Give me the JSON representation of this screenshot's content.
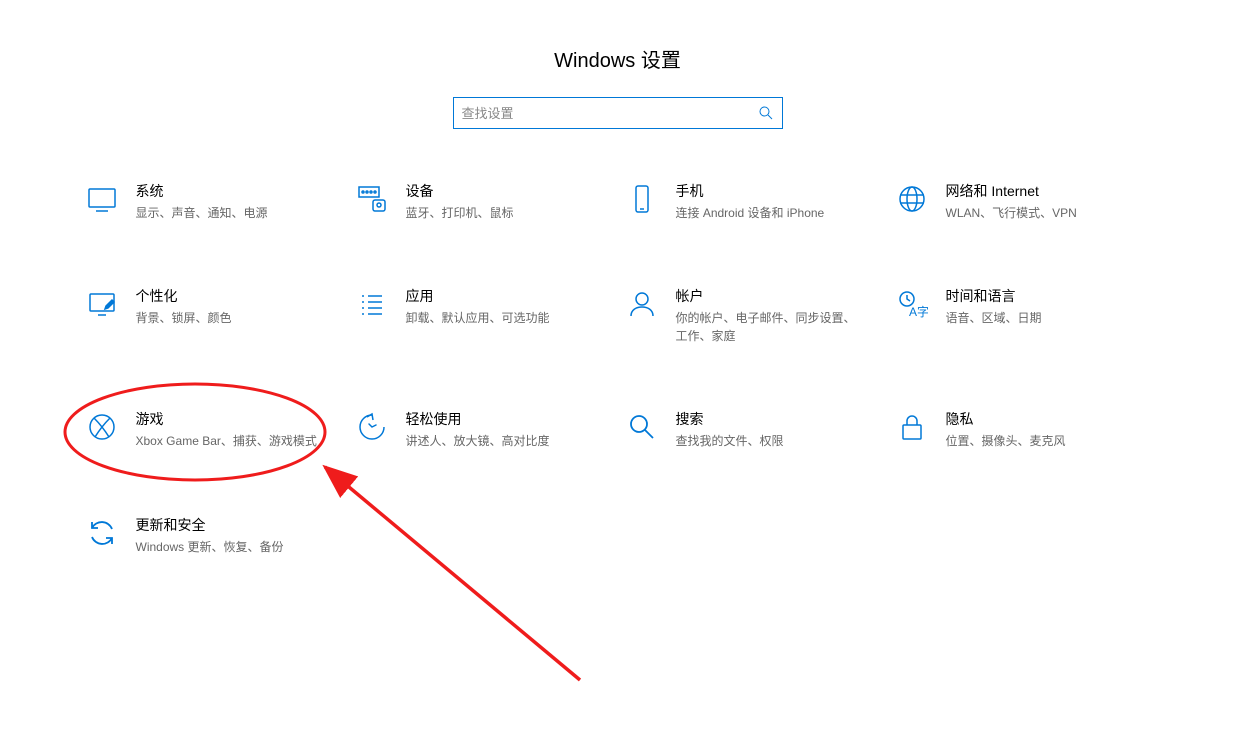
{
  "header": {
    "title": "Windows 设置"
  },
  "search": {
    "placeholder": "查找设置"
  },
  "items": {
    "system": {
      "label": "系统",
      "desc": "显示、声音、通知、电源"
    },
    "devices": {
      "label": "设备",
      "desc": "蓝牙、打印机、鼠标"
    },
    "phone": {
      "label": "手机",
      "desc": "连接 Android 设备和 iPhone"
    },
    "network": {
      "label": "网络和 Internet",
      "desc": "WLAN、飞行模式、VPN"
    },
    "personal": {
      "label": "个性化",
      "desc": "背景、锁屏、颜色"
    },
    "apps": {
      "label": "应用",
      "desc": "卸载、默认应用、可选功能"
    },
    "accounts": {
      "label": "帐户",
      "desc": "你的帐户、电子邮件、同步设置、工作、家庭"
    },
    "time": {
      "label": "时间和语言",
      "desc": "语音、区域、日期"
    },
    "gaming": {
      "label": "游戏",
      "desc": "Xbox Game Bar、捕获、游戏模式"
    },
    "ease": {
      "label": "轻松使用",
      "desc": "讲述人、放大镜、高对比度"
    },
    "searchcat": {
      "label": "搜索",
      "desc": "查找我的文件、权限"
    },
    "privacy": {
      "label": "隐私",
      "desc": "位置、摄像头、麦克风"
    },
    "update": {
      "label": "更新和安全",
      "desc": "Windows 更新、恢复、备份"
    }
  },
  "annotation": {
    "highlight_target": "gaming"
  }
}
